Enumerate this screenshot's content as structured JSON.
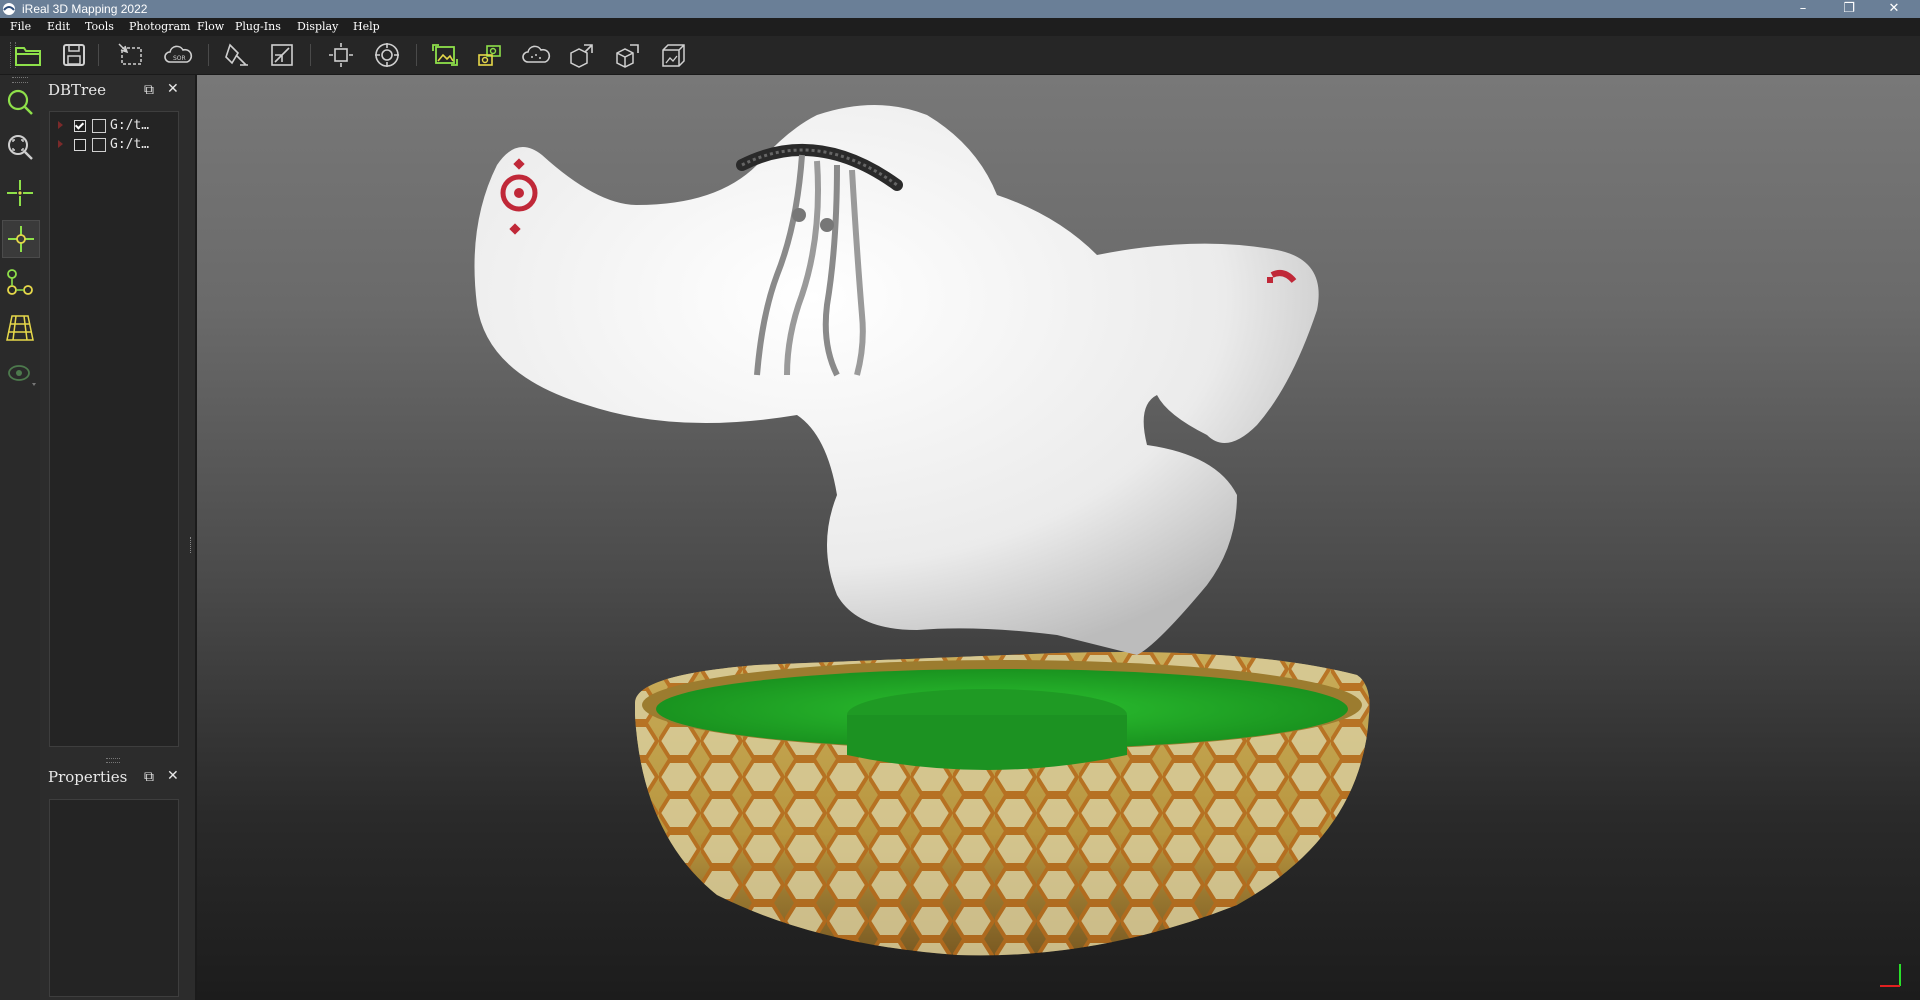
{
  "window": {
    "title": "iReal 3D Mapping 2022",
    "minimize_glyph": "–",
    "restore_glyph": "❐",
    "close_glyph": "✕"
  },
  "menu": [
    "File",
    "Edit",
    "Tools",
    "Photogram",
    "Flow",
    "Plug-Ins",
    "Display",
    "Help"
  ],
  "toolbar": {
    "icons": [
      "open-folder-icon",
      "save-icon",
      "point-cloud-select-icon",
      "cloud-sor-icon",
      "pen-tool-icon",
      "scale-icon",
      "transform-icon",
      "target-icon",
      "image-capture-icon",
      "camera-sync-icon",
      "cloud-dots-icon",
      "export-icon",
      "mesh-export-icon",
      "box-texture-icon"
    ],
    "sor_text": "SOR"
  },
  "left_tools": [
    "zoom-icon",
    "zoom-fit-icon",
    "crosshair-icon",
    "pick-center-icon",
    "node-graph-icon",
    "grid-perspective-icon",
    "eye-icon"
  ],
  "dbtree": {
    "title": "DBTree",
    "items": [
      {
        "label": "G:/t…",
        "checked": true
      },
      {
        "label": "G:/t…",
        "checked": false
      }
    ]
  },
  "properties": {
    "title": "Properties"
  },
  "panel_controls": {
    "float_glyph": "⧉",
    "close_glyph": "✕"
  },
  "colors": {
    "accent_green": "#8ee04a",
    "accent_yellow": "#e6d84a",
    "titlebar": "#6a7f97",
    "model_base_green": "#26a82a",
    "model_gold": "#b89a48",
    "model_red": "#c02838"
  }
}
